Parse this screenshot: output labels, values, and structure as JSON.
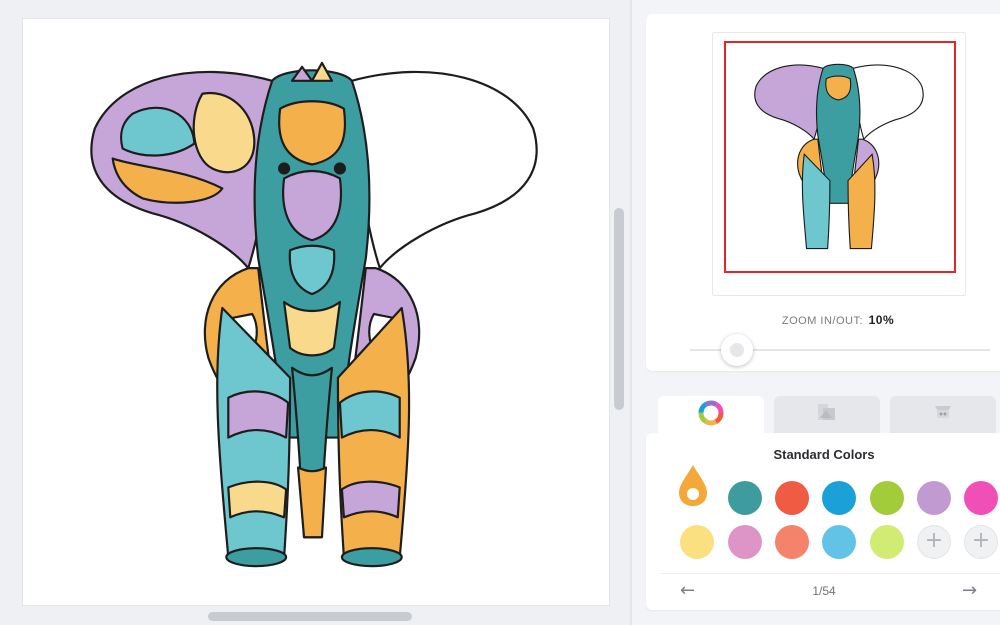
{
  "canvas": {
    "artwork": "mandala-elephant-coloring-page",
    "palette": {
      "teal": "#3c9ea0",
      "aqua": "#6ec7cf",
      "purple": "#c6a6d8",
      "orange": "#f4b04a",
      "peach": "#f9d98b",
      "outline": "#1d1d1d"
    }
  },
  "preview": {
    "zoom_label": "ZOOM IN/OUT:",
    "zoom_value": "10%",
    "zoom_fraction": 0.1,
    "viewport_color": "#e3262b"
  },
  "tabs": [
    {
      "name": "colors",
      "icon": "color-wheel-icon",
      "active": true
    },
    {
      "name": "layers",
      "icon": "layers-icon",
      "active": false
    },
    {
      "name": "tools",
      "icon": "tools-icon",
      "active": false
    }
  ],
  "palette_panel": {
    "title": "Standard Colors",
    "selected_color": "#f4a83a",
    "rows": [
      [
        "#3f9c9e",
        "#ef5c43",
        "#1ba0d8",
        "#a3cc3b",
        "#c09ad0",
        "#f04fb8"
      ],
      [
        "#fbe07f",
        "#df94c8",
        "#f5836b",
        "#63c3e6",
        "#d1ec72",
        "add",
        "add"
      ]
    ],
    "add_symbol": "+",
    "page": "1/54",
    "prev": "←",
    "next": "→"
  }
}
